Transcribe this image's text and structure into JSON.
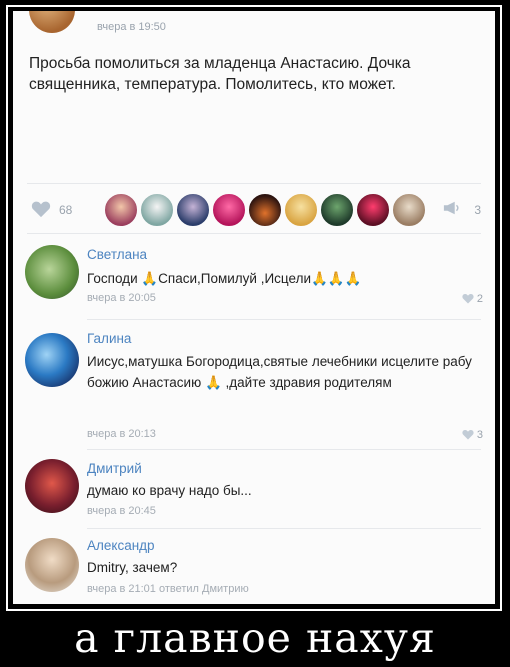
{
  "post": {
    "time": "вчера в 19:50",
    "text": "Просьба помолиться за младенца Анастасию. Дочка священника, температура. Помолитесь, кто может."
  },
  "likes": {
    "count": "68",
    "share_count": "3"
  },
  "comments": [
    {
      "name": "Светлана",
      "text": "Господи 🙏Спаси,Помилуй ,Исцели🙏🙏🙏",
      "time": "вчера в 20:05",
      "likes": "2"
    },
    {
      "name": "Галина",
      "text": "Иисус,матушка Богородица,святые лечебники исцелите рабу божию Анастасию 🙏 ,дайте здравия родителям",
      "time": "вчера в 20:13",
      "likes": "3"
    },
    {
      "name": "Дмитрий",
      "text": "думаю ко врачу надо бы...",
      "time": "вчера в 20:45",
      "likes": ""
    },
    {
      "name": "Александр",
      "text": "Dmitry, зачем?",
      "time": "вчера в 21:01 ответил Дмитрию",
      "likes": ""
    }
  ],
  "caption": "а главное нахуя"
}
